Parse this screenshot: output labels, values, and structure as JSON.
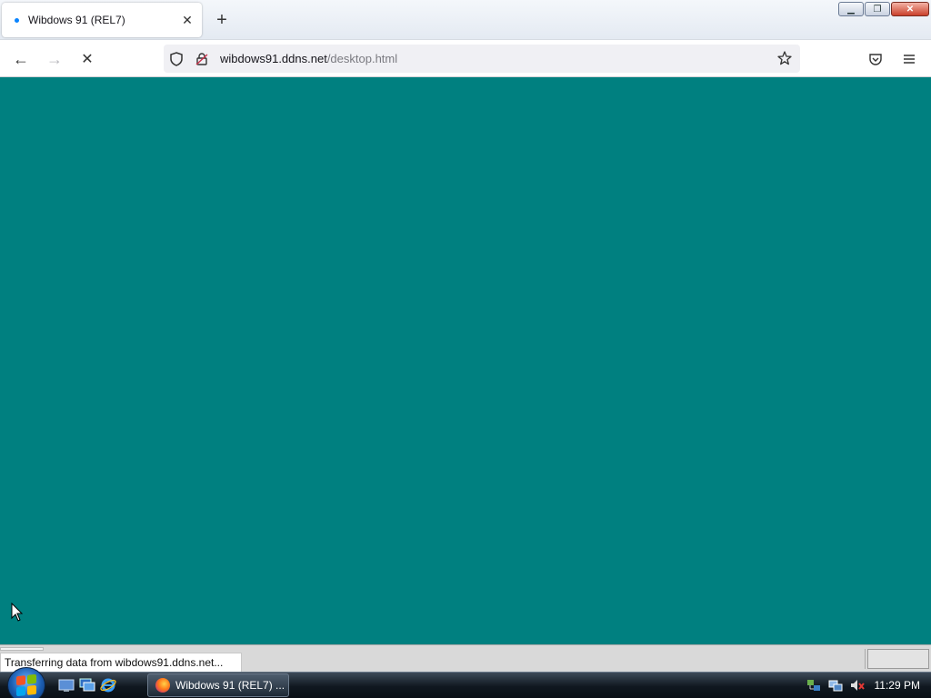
{
  "browser": {
    "tab": {
      "title": "Wibdows 91 (REL7)",
      "close_glyph": "✕"
    },
    "new_tab_glyph": "+",
    "window_buttons": {
      "minimize_glyph": "▁",
      "restore_glyph": "❐",
      "close_glyph": "✕"
    },
    "nav": {
      "back_glyph": "←",
      "forward_glyph": "→",
      "stop_glyph": "✕"
    },
    "url": {
      "host": "wibdows91.ddns.net",
      "path": "/desktop.html"
    },
    "status_text": "Transferring data from wibdows91.ddns.net..."
  },
  "page": {
    "background_color": "#008080"
  },
  "taskbar": {
    "task_button_label": "Wibdows 91 (REL7) ...",
    "clock": "11:29 PM"
  },
  "icons": {
    "tab": "loading-dot-icon",
    "url_left": [
      "shield-icon",
      "site-info-icon"
    ],
    "url_right": "bookmark-star-icon",
    "toolbar_right": [
      "pocket-icon",
      "hamburger-menu-icon"
    ],
    "quick_launch": [
      "show-desktop-icon",
      "switch-windows-icon",
      "internet-explorer-icon"
    ],
    "tray": [
      "network-icon",
      "network-status-icon",
      "volume-muted-icon"
    ]
  }
}
